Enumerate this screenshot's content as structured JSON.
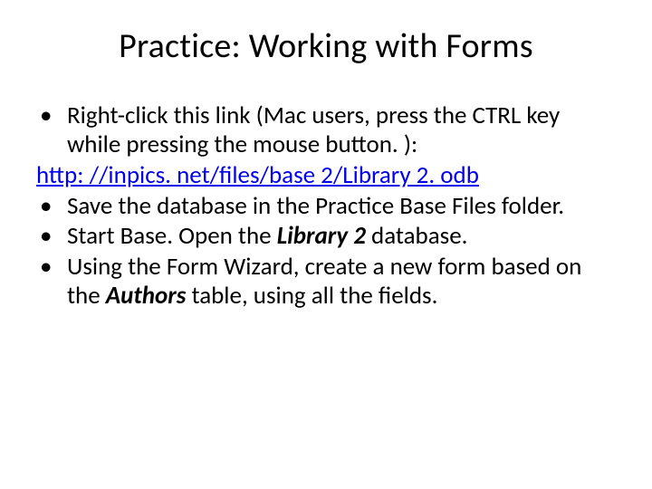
{
  "title": "Practice: Working with Forms",
  "items": {
    "b1": "Right-click this link (Mac users, press the CTRL key while pressing the mouse button. ):",
    "link": "http: //inpics. net/files/base 2/Library 2. odb",
    "b2": "Save the database in the Practice Base Files folder.",
    "b3a": "Start Base. Open the ",
    "b3b": "Library 2",
    "b3c": " database.",
    "b4a": "Using the Form Wizard, create a new form based on the ",
    "b4b": "Authors",
    "b4c": " table, using all the fields."
  }
}
